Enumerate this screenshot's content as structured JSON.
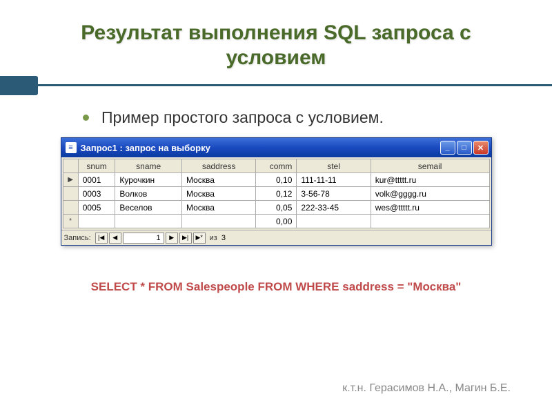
{
  "slide": {
    "title": "Результат выполнения SQL запроса с условием",
    "bullet_text": "Пример простого запроса с условием.",
    "sql": "SELECT * FROM Salespeople FROM WHERE saddress = \"Москва\"",
    "author": "к.т.н. Герасимов Н.А., Магин Б.Е."
  },
  "window": {
    "title": "Запрос1 : запрос на выборку",
    "columns": [
      "snum",
      "sname",
      "saddress",
      "comm",
      "stel",
      "semail"
    ],
    "rows": [
      {
        "selector": "▶",
        "snum": "0001",
        "sname": "Курочкин",
        "saddress": "Москва",
        "comm": "0,10",
        "stel": "111-11-11",
        "semail": "kur@ttttt.ru"
      },
      {
        "selector": "",
        "snum": "0003",
        "sname": "Волков",
        "saddress": "Москва",
        "comm": "0,12",
        "stel": "3-56-78",
        "semail": "volk@gggg.ru"
      },
      {
        "selector": "",
        "snum": "0005",
        "sname": "Веселов",
        "saddress": "Москва",
        "comm": "0,05",
        "stel": "222-33-45",
        "semail": "wes@ttttt.ru"
      },
      {
        "selector": "*",
        "snum": "",
        "sname": "",
        "saddress": "",
        "comm": "0,00",
        "stel": "",
        "semail": ""
      }
    ],
    "nav": {
      "label": "Запись:",
      "current": "1",
      "of_label": "из",
      "total": "3"
    }
  }
}
